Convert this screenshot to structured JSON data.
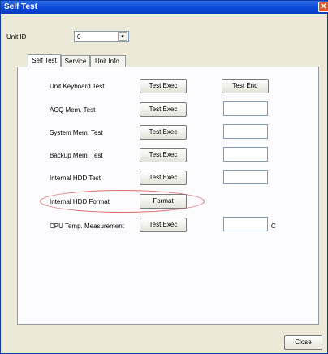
{
  "window": {
    "title": "Self Test",
    "close_glyph": "✕"
  },
  "unit": {
    "label": "Unit ID",
    "value": "0",
    "arrow_glyph": "▾"
  },
  "tabs": [
    {
      "label": "Self Test",
      "active": true
    },
    {
      "label": "Service",
      "active": false
    },
    {
      "label": "Unit Info.",
      "active": false
    }
  ],
  "rows": [
    {
      "label": "Unit Keyboard Test",
      "button": "Test Exec",
      "end_button": "Test End"
    },
    {
      "label": "ACQ Mem. Test",
      "button": "Test Exec"
    },
    {
      "label": "System Mem. Test",
      "button": "Test Exec"
    },
    {
      "label": "Backup Mem. Test",
      "button": "Test Exec"
    },
    {
      "label": "Internal HDD Test",
      "button": "Test Exec"
    },
    {
      "label": "Internal HDD Format",
      "button": "Format"
    },
    {
      "label": "CPU Temp. Measurement",
      "button": "Test Exec",
      "unit": "C"
    }
  ],
  "footer": {
    "close_label": "Close"
  },
  "colors": {
    "titlebar": "#0a48d8",
    "highlight": "#e06b6b"
  }
}
